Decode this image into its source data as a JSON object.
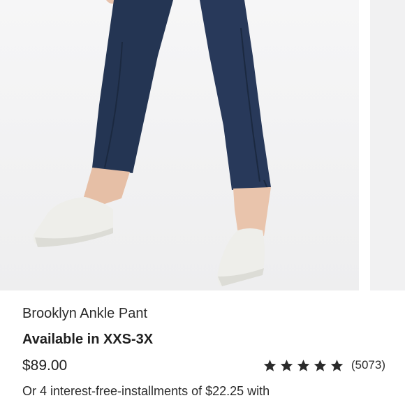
{
  "product": {
    "image_icon": "product-photo",
    "title": "Brooklyn Ankle Pant",
    "availability": "Available in XXS-3X",
    "price": "$89.00",
    "rating": {
      "stars": 5,
      "max_stars": 5,
      "star_icon": "star-icon",
      "review_count": "(5073)"
    },
    "installments": "Or 4 interest-free-installments of $22.25 with"
  },
  "colors": {
    "pant_navy": "#243553",
    "sneaker_white": "#eeeeea",
    "photo_background": "#f3f3f4",
    "text": "#1f1f1f"
  }
}
